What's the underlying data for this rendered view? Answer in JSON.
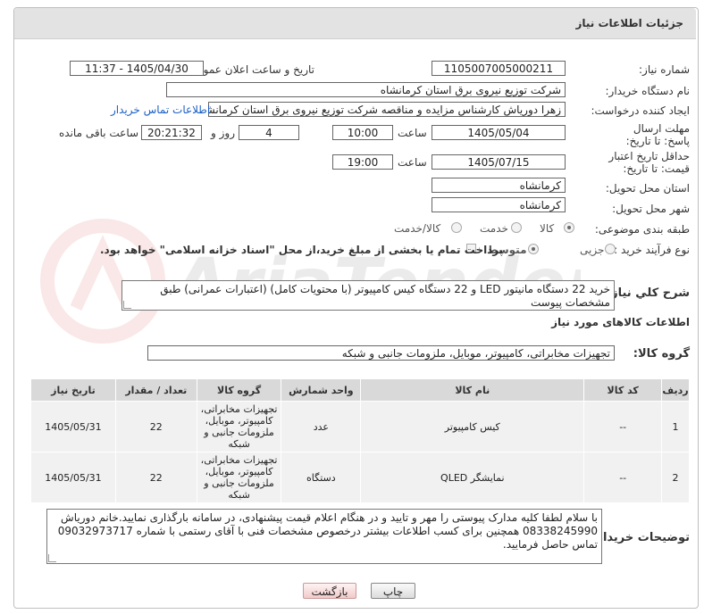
{
  "header": {
    "title": "جزئیات اطلاعات نیاز"
  },
  "form": {
    "need_number": {
      "label": "شماره نیاز:",
      "value": "1105007005000211"
    },
    "announce_datetime": {
      "label": "تاریخ و ساعت اعلان عمومی:",
      "value": "1405/04/30 - 11:37"
    },
    "buyer_org": {
      "label": "نام دستگاه خریدار:",
      "value": "شرکت توزیع نیروی برق استان کرمانشاه"
    },
    "requester": {
      "label": "ایجاد کننده درخواست:",
      "value": "زهرا دوریاش کارشناس مزایده و مناقصه شرکت توزیع نیروی برق استان کرمانشاه",
      "contact_link": "اطلاعات تماس خریدار"
    },
    "reply_deadline": {
      "label": "مهلت ارسال پاسخ: تا تاریخ:",
      "date": "1405/05/04",
      "time_label": "ساعت",
      "time": "10:00",
      "days": "4",
      "days_label": "روز و",
      "remaining_time": "20:21:32",
      "remaining_label": "ساعت باقی مانده"
    },
    "price_validity": {
      "label": "حداقل تاریخ اعتبار قیمت: تا تاریخ:",
      "date": "1405/07/15",
      "time_label": "ساعت",
      "time": "19:00"
    },
    "delivery_province": {
      "label": "استان محل تحویل:",
      "value": "کرمانشاه"
    },
    "delivery_city": {
      "label": "شهر محل تحویل:",
      "value": "کرمانشاه"
    },
    "category": {
      "label": "طبقه بندی موضوعی:",
      "options": [
        "کالا",
        "خدمت",
        "کالا/خدمت"
      ],
      "selected": "کالا"
    },
    "purchase_type": {
      "label": "نوع فرآیند خرید :",
      "options": [
        "جزیی",
        "متوسط"
      ],
      "selected": "متوسط",
      "payment_note": "پرداخت تمام یا بخشی از مبلغ خرید،از محل \"اسناد خزانه اسلامی\" خواهد بود."
    }
  },
  "description": {
    "label": "شرح کلي نياز:",
    "value": "خرید 22 دستگاه مانیتور LED و 22 دستگاه کیس کامپیوتر (با محتویات کامل) (اعتبارات عمرانی) طبق مشخصات پیوست"
  },
  "goods_section": {
    "title": "اطلاعات کالاهای مورد نیاز",
    "group_label": "گروه کالا:",
    "group_value": "تجهیزات مخابراتی، کامپیوتر، موبایل، ملزومات جانبی و شبکه"
  },
  "table": {
    "headers": [
      "ردیف",
      "کد کالا",
      "نام کالا",
      "واحد شمارش",
      "گروه کالا",
      "تعداد / مقدار",
      "تاریخ نیاز"
    ],
    "rows": [
      {
        "index": "1",
        "code": "--",
        "name": "کیس کامپیوتر",
        "unit": "عدد",
        "group": "تجهیزات مخابراتی، کامپیوتر، موبایل، ملزومات جانبی و شبکه",
        "qty": "22",
        "date": "1405/05/31"
      },
      {
        "index": "2",
        "code": "--",
        "name": "نمایشگر QLED",
        "unit": "دستگاه",
        "group": "تجهیزات مخابراتی، کامپیوتر، موبایل، ملزومات جانبی و شبکه",
        "qty": "22",
        "date": "1405/05/31"
      }
    ]
  },
  "buyer_notes": {
    "label": "توضیحات خریدار:",
    "value": "با سلام لطفا کلیه مدارک پیوستی را مهر و تایید و در هنگام اعلام قیمت پیشنهادی، در سامانه بارگذاری نمایید.خانم دوریاش 08338245990 همچنین برای کسب اطلاعات بیشتر درخصوص مشخصات فنی با آقای رستمی با شماره 09032973717 تماس حاصل فرمایید."
  },
  "buttons": {
    "print": "چاپ",
    "back": "بازگشت"
  },
  "watermark": {
    "text": "AriaTender.net"
  }
}
